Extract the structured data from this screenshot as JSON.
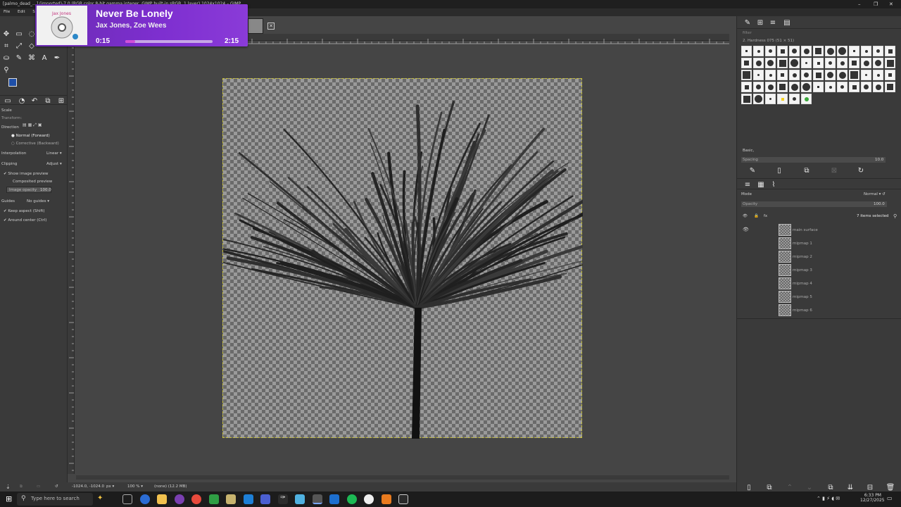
{
  "window": {
    "title": "[palmo_dead_...] (imported)-7.0 (RGB color 8-bit gamma integer, GIMP built-in sRGB, 1 layer) 1024x1024 – GIMP",
    "min": "–",
    "max": "❐",
    "close": "✕"
  },
  "menu": [
    "File",
    "Edit",
    "Select"
  ],
  "music_widget": {
    "title": "Never Be Lonely",
    "artist": "Jax Jones, Zoe Wees",
    "elapsed": "0:15",
    "duration": "2:15",
    "progress": 0.11,
    "album_text": "Jax Jones",
    "accent": "#d14fd8"
  },
  "tool_options": {
    "section_title": "Scale",
    "transform_label": "Transform:",
    "direction_label": "Direction",
    "direction_options": [
      "Normal (Forward)",
      "Corrective (Backward)"
    ],
    "interpolation_label": "Interpolation",
    "interpolation_value": "Linear",
    "clipping_label": "Clipping",
    "clipping_value": "Adjust",
    "show_preview": "Show image preview",
    "composited_preview": "Composited preview",
    "image_opacity_label": "Image opacity",
    "image_opacity_value": "100.0",
    "guides_label": "Guides",
    "guides_value": "No guides",
    "keep_aspect": "Keep aspect (Shift)",
    "around_center": "Around center (Ctrl)"
  },
  "status": {
    "coords": "-1024.0, -1024.0",
    "unit": "px",
    "zoom": "100 %",
    "info": "(none) (12.2 MB)"
  },
  "brushes": {
    "filter_placeholder": "filter",
    "current_brush": "2. Hardness 075 (51 × 51)",
    "preset_label": "Basic,",
    "spacing_label": "Spacing",
    "spacing_value": "10.0"
  },
  "layers": {
    "mode_label": "Mode",
    "mode_value": "Normal",
    "opacity_label": "Opacity",
    "opacity_value": "100.0",
    "selected_count": "7 items selected",
    "items": [
      "main surface",
      "mipmap 1",
      "mipmap 2",
      "mipmap 3",
      "mipmap 4",
      "mipmap 5",
      "mipmap 6"
    ]
  },
  "taskbar": {
    "search_placeholder": "Type here to search",
    "time": "6:33 PM",
    "date": "12/27/2025"
  }
}
